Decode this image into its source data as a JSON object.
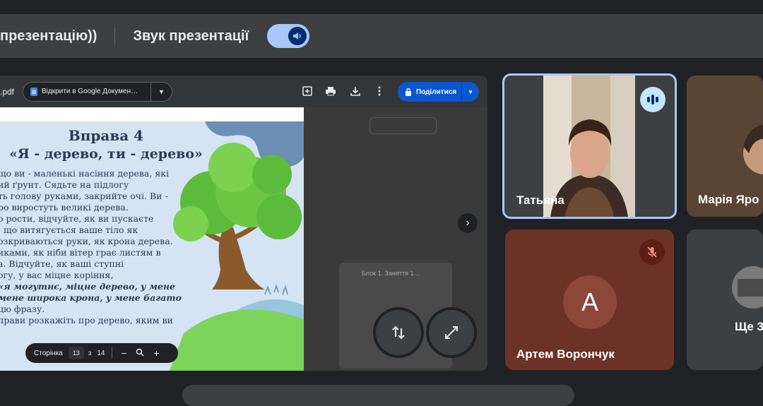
{
  "banner": {
    "presenting_label": "презентацію))",
    "sound_label": "Звук презентації",
    "sound_toggle": "on"
  },
  "pdf_viewer": {
    "file_name": ".pdf",
    "open_in_label": "Відкрити в Google Докумен…",
    "share_label": "Поділитися",
    "page_label": "Сторінка",
    "current_page": "13",
    "page_of": "з",
    "total_pages": "14",
    "zoom_out": "−",
    "zoom_in": "+"
  },
  "slide": {
    "title": "Вправа 4",
    "subtitle": "«Я - дерево, ти - дерево»",
    "lines": [
      "що ви - маленькі насіння дерева, які",
      "ий ґрунт. Сядьте на підлогу",
      "ть голову руками, закрийте очі. Ви -",
      "ро виростуть великі дерева.",
      "о рости, відчуйте, як ви пускаєте",
      ", що витягується ваше тіло як",
      "озкриваються руки, як крона дерева.",
      "иками, як ніби вітер грає листям в",
      "а. Відчуйте, як ваші ступні",
      "огу, у вас міцне коріння,"
    ],
    "emphasis_lines": [
      "«я могутнє, міцне дерево, у мене",
      "мене широка крона, у мене багато"
    ],
    "end_lines": [
      "цю фразу.",
      "прави розкажіть про дерево, яким ви"
    ]
  },
  "side_thumbnail": {
    "title": "Блок 1. Заняття 1…"
  },
  "participants": [
    {
      "name": "Татьяна",
      "state": "speaking"
    },
    {
      "name": "Марія Яро",
      "state": "video"
    },
    {
      "name": "Артем Ворончук",
      "initial": "A",
      "state": "muted"
    },
    {
      "name": "Ще 3",
      "state": "more"
    }
  ],
  "colors": {
    "accent": "#a8c7fa",
    "share": "#0b57d0",
    "tile_artem": "#6d3226",
    "speaking_border": "#a8c7fa"
  }
}
